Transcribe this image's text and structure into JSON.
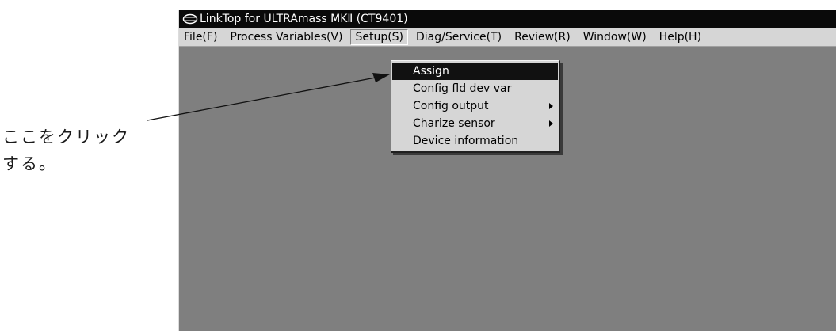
{
  "window": {
    "title": "LinkTop for ULTRAmass MKⅡ (CT9401)",
    "icon": "hart-modem-icon"
  },
  "menubar": {
    "items": [
      {
        "label": "File(F)",
        "key": "file"
      },
      {
        "label": "Process Variables(V)",
        "key": "process-variables"
      },
      {
        "label": "Setup(S)",
        "key": "setup",
        "active": true
      },
      {
        "label": "Diag/Service(T)",
        "key": "diag-service"
      },
      {
        "label": "Review(R)",
        "key": "review"
      },
      {
        "label": "Window(W)",
        "key": "window"
      },
      {
        "label": "Help(H)",
        "key": "help"
      }
    ]
  },
  "setup_menu": {
    "items": [
      {
        "label": "Assign",
        "selected": true,
        "submenu": false
      },
      {
        "label": "Config fld dev var",
        "selected": false,
        "submenu": false
      },
      {
        "label": "Config output",
        "selected": false,
        "submenu": true
      },
      {
        "label": "Charize sensor",
        "selected": false,
        "submenu": true
      },
      {
        "label": "Device information",
        "selected": false,
        "submenu": false
      }
    ]
  },
  "annotation": {
    "line1": "ここをクリック",
    "line2": "する。"
  },
  "colors": {
    "titlebar": "#0a0a0a",
    "menubar": "#d6d6d6",
    "workspace": "#7f7f7f",
    "highlight": "#111111"
  }
}
